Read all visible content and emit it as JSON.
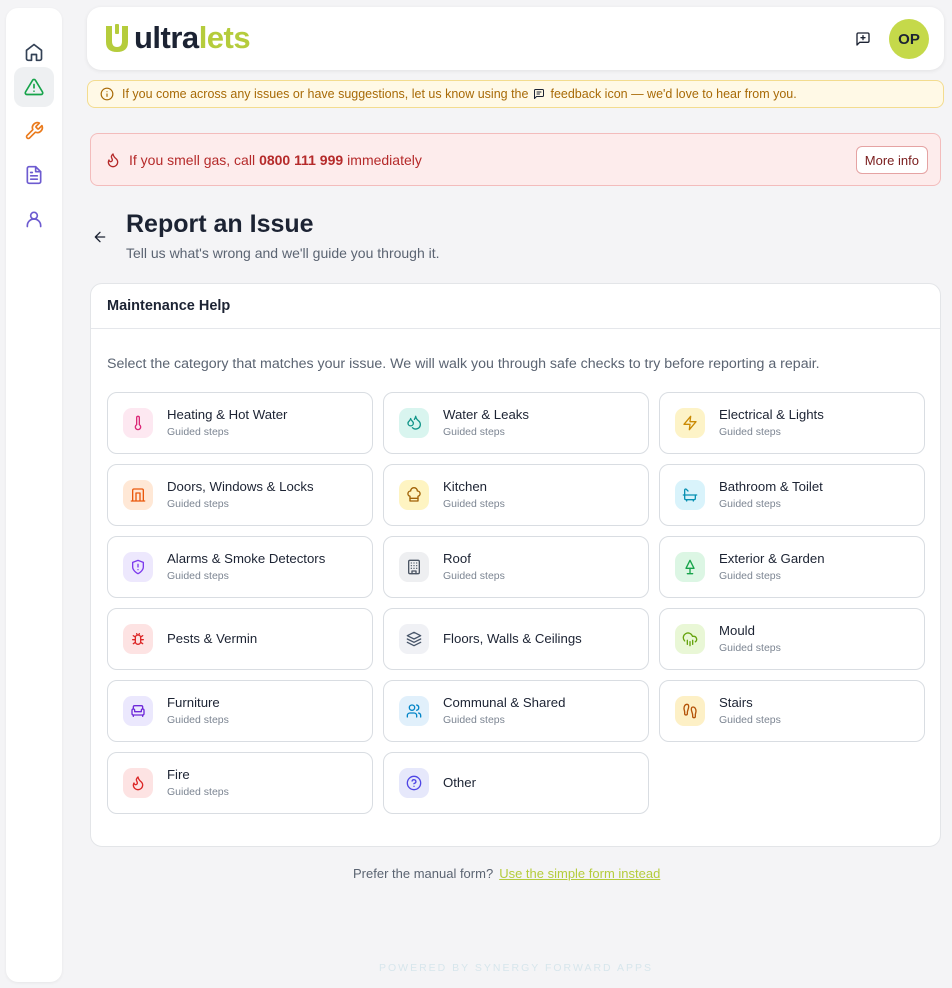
{
  "colors": {
    "brand_green": "#b5cc3c",
    "brand_dark": "#1c2333",
    "avatar_bg": "#c5d94a",
    "notice_bg": "#fff9e6",
    "notice_text": "#a86a07",
    "alert_bg": "#fdecec",
    "alert_text": "#b52a2a"
  },
  "sidebar": {
    "items": [
      {
        "name": "home",
        "icon": "home-icon",
        "active": false,
        "color": "#334155"
      },
      {
        "name": "issues",
        "icon": "warning-triangle-icon",
        "active": true,
        "color": "#16a34a"
      },
      {
        "name": "repairs",
        "icon": "wrench-icon",
        "active": false,
        "color": "#ea7a1c"
      },
      {
        "name": "documents",
        "icon": "document-icon",
        "active": false,
        "color": "#6d5bd0"
      },
      {
        "name": "profile",
        "icon": "user-icon",
        "active": false,
        "color": "#6d5bd0"
      }
    ]
  },
  "header": {
    "logo_part1": "ultra",
    "logo_part2": "lets",
    "feedback_icon": "feedback-icon",
    "avatar_initials": "OP"
  },
  "notice": {
    "text_before": "If you come across any issues or have suggestions, let us know using the",
    "text_after": "feedback icon — we'd love to hear from you."
  },
  "gas_alert": {
    "text_before": "If you smell gas, call",
    "phone": "0800 111 999",
    "text_after": "immediately",
    "button_label": "More info"
  },
  "page": {
    "title": "Report an Issue",
    "subtitle": "Tell us what's wrong and we'll guide you through it."
  },
  "card": {
    "title": "Maintenance Help",
    "description": "Select the category that matches your issue. We will walk you through safe checks to try before reporting a repair."
  },
  "categories": [
    {
      "label": "Heating & Hot Water",
      "sub": "Guided steps",
      "icon": "thermometer-icon",
      "bg": "#fde8f1",
      "fg": "#db2777"
    },
    {
      "label": "Water & Leaks",
      "sub": "Guided steps",
      "icon": "droplets-icon",
      "bg": "#d9f5ef",
      "fg": "#0f9488"
    },
    {
      "label": "Electrical & Lights",
      "sub": "Guided steps",
      "icon": "lightning-icon",
      "bg": "#fdf3c7",
      "fg": "#ca8a04"
    },
    {
      "label": "Doors, Windows & Locks",
      "sub": "Guided steps",
      "icon": "door-icon",
      "bg": "#ffe8d6",
      "fg": "#ea580c"
    },
    {
      "label": "Kitchen",
      "sub": "Guided steps",
      "icon": "chef-hat-icon",
      "bg": "#fef4c2",
      "fg": "#a16207"
    },
    {
      "label": "Bathroom & Toilet",
      "sub": "Guided steps",
      "icon": "bath-icon",
      "bg": "#d9f3fb",
      "fg": "#0891b2"
    },
    {
      "label": "Alarms & Smoke Detectors",
      "sub": "Guided steps",
      "icon": "shield-alert-icon",
      "bg": "#ede8fd",
      "fg": "#7c3aed"
    },
    {
      "label": "Roof",
      "sub": "Guided steps",
      "icon": "building-icon",
      "bg": "#eeeff1",
      "fg": "#4b5563"
    },
    {
      "label": "Exterior & Garden",
      "sub": "Guided steps",
      "icon": "tree-icon",
      "bg": "#dcf6e4",
      "fg": "#16a34a"
    },
    {
      "label": "Pests & Vermin",
      "sub": "",
      "icon": "bug-icon",
      "bg": "#fde3e3",
      "fg": "#dc2626"
    },
    {
      "label": "Floors, Walls & Ceilings",
      "sub": "",
      "icon": "layers-icon",
      "bg": "#f0f1f5",
      "fg": "#475569"
    },
    {
      "label": "Mould",
      "sub": "Guided steps",
      "icon": "cloud-rain-icon",
      "bg": "#e9f7d6",
      "fg": "#65a30d"
    },
    {
      "label": "Furniture",
      "sub": "Guided steps",
      "icon": "armchair-icon",
      "bg": "#ebe8fd",
      "fg": "#6d28d9"
    },
    {
      "label": "Communal & Shared",
      "sub": "Guided steps",
      "icon": "users-icon",
      "bg": "#e1f0fb",
      "fg": "#0284c7"
    },
    {
      "label": "Stairs",
      "sub": "Guided steps",
      "icon": "footprints-icon",
      "bg": "#fdf0c6",
      "fg": "#b45309"
    },
    {
      "label": "Fire",
      "sub": "Guided steps",
      "icon": "flame-icon",
      "bg": "#fde3e3",
      "fg": "#dc2626"
    },
    {
      "label": "Other",
      "sub": "",
      "icon": "help-circle-icon",
      "bg": "#e6e8fb",
      "fg": "#4f46e5"
    }
  ],
  "footer": {
    "manual_prompt": "Prefer the manual form?",
    "manual_link": "Use the simple form instead",
    "powered_by": "POWERED BY SYNERGY FORWARD APPS"
  }
}
